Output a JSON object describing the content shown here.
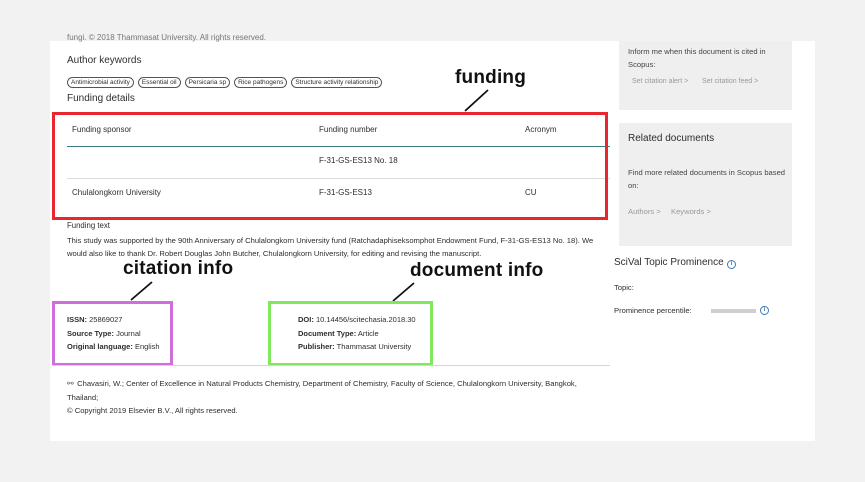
{
  "fragment": "fungi. © 2018 Thammasat University. All rights reserved.",
  "author_keywords": {
    "title": "Author keywords",
    "items": [
      "Antimicrobial activity",
      "Essential oil",
      "Persicaria sp",
      "Rice pathogens",
      "Structure activity relationship"
    ]
  },
  "funding": {
    "title": "Funding details",
    "headers": [
      "Funding sponsor",
      "Funding number",
      "Acronym"
    ],
    "rows": [
      {
        "sponsor": "",
        "number": "F-31-GS-ES13 No. 18",
        "acronym": ""
      },
      {
        "sponsor": "Chulalongkorn University",
        "number": "F-31-GS-ES13",
        "acronym": "CU"
      }
    ],
    "text_title": "Funding text",
    "text": "This study was supported by the 90th Anniversary of Chulalongkorn University fund (Ratchadaphiseksomphot Endowment Fund, F-31-GS-ES13 No. 18). We would also like to thank Dr. Robert Douglas John Butcher, Chulalongkorn University, for editing and revising the manuscript."
  },
  "annotations": {
    "funding": "funding",
    "citation": "citation info",
    "document": "document info",
    "colors": {
      "funding": "#e8262e",
      "citation": "#cf6fdc",
      "document": "#7fe85f"
    }
  },
  "citation_info": {
    "issn_label": "ISSN:",
    "issn": "25869027",
    "source_label": "Source Type:",
    "source": "Journal",
    "lang_label": "Original language:",
    "lang": "English"
  },
  "document_info": {
    "doi_label": "DOI:",
    "doi": "10.14456/scitechasia.2018.30",
    "type_label": "Document Type:",
    "type": "Article",
    "publisher_label": "Publisher:",
    "publisher": "Thammasat University"
  },
  "affiliation": {
    "text": "Chavasiri, W.; Center of Excellence in Natural Products Chemistry, Department of Chemistry, Faculty of Science, Chulalongkorn University, Bangkok, Thailand;",
    "copyright": "© Copyright 2019 Elsevier B.V., All rights reserved."
  },
  "sidebar": {
    "cite_alert_text": "Inform me when this document is cited in Scopus:",
    "citation_alert": "Set citation alert >",
    "citation_feed": "Set citation feed >",
    "related_title": "Related documents",
    "related_text": "Find more related documents in Scopus based on:",
    "authors_link": "Authors >",
    "keywords_link": "Keywords >",
    "scival_title": "SciVal Topic Prominence",
    "topic_label": "Topic:",
    "prominence_label": "Prominence percentile:"
  }
}
